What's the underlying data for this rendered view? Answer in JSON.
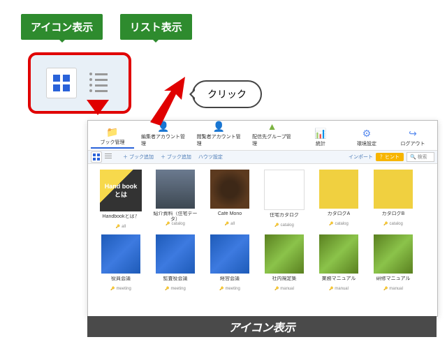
{
  "labels": {
    "icon_view": "アイコン表示",
    "list_view": "リスト表示",
    "click": "クリック"
  },
  "toolbar": [
    {
      "label": "ブック管理",
      "color": "#f0a030"
    },
    {
      "label": "編集者アカウント管理",
      "color": "#5b8def"
    },
    {
      "label": "閲覧者アカウント管理",
      "color": "#5b8def"
    },
    {
      "label": "配信先グループ管理",
      "color": "#7cb342"
    },
    {
      "label": "統計",
      "color": "#f0a030"
    },
    {
      "label": "環境設定",
      "color": "#5b8def"
    },
    {
      "label": "ログアウト",
      "color": "#5b8def"
    }
  ],
  "sub_toolbar": {
    "actions": [
      "＋ ブック追加",
      "＋ ブック追加",
      "ハウツ設定"
    ],
    "import": "インポート",
    "hint": "？ヒント",
    "search": "検索"
  },
  "books": [
    {
      "title": "Handbookとは？",
      "tag": "all",
      "thumb_class": "t-hand",
      "thumb_text": "Hand book とは"
    },
    {
      "title": "紹介資料（住宅データ）",
      "tag": "catalog",
      "thumb_class": "t-photo",
      "thumb_text": ""
    },
    {
      "title": "Café Mono",
      "tag": "all",
      "thumb_class": "t-coffee",
      "thumb_text": ""
    },
    {
      "title": "住宅カタログ",
      "tag": "catalog",
      "thumb_class": "t-white",
      "thumb_text": ""
    },
    {
      "title": "カタログA",
      "tag": "catalog",
      "thumb_class": "t-yellow",
      "thumb_text": ""
    },
    {
      "title": "カタログB",
      "tag": "catalog",
      "thumb_class": "t-yellow",
      "thumb_text": ""
    },
    {
      "title": "役員会議",
      "tag": "meeting",
      "thumb_class": "t-blue",
      "thumb_text": ""
    },
    {
      "title": "監査役会議",
      "tag": "meeting",
      "thumb_class": "t-blue",
      "thumb_text": ""
    },
    {
      "title": "経営会議",
      "tag": "meeting",
      "thumb_class": "t-blue",
      "thumb_text": ""
    },
    {
      "title": "社内規定集",
      "tag": "manual",
      "thumb_class": "t-green",
      "thumb_text": ""
    },
    {
      "title": "業務マニュアル",
      "tag": "manual",
      "thumb_class": "t-green",
      "thumb_text": ""
    },
    {
      "title": "研修マニュアル",
      "tag": "manual",
      "thumb_class": "t-green",
      "thumb_text": ""
    }
  ],
  "bottom_label": "アイコン表示"
}
